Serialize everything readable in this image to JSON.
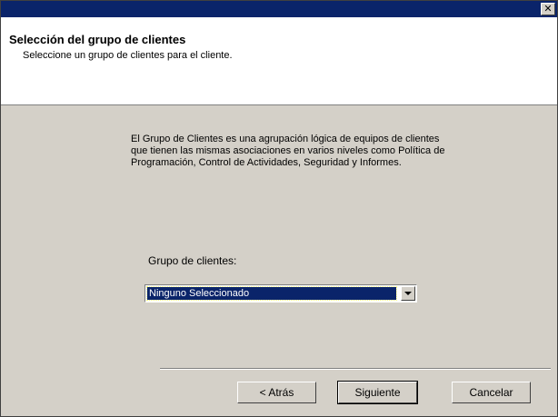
{
  "window": {
    "close_glyph": "✕"
  },
  "header": {
    "title": "Selección del grupo de clientes",
    "subtitle": "Seleccione un grupo de clientes para el cliente."
  },
  "main": {
    "description": "El Grupo de Clientes es una agrupación lógica de equipos de clientes que tienen las mismas asociaciones en varios niveles como Política de Programación, Control de Actividades, Seguridad y Informes.",
    "group_label": "Grupo de clientes:",
    "group_select": {
      "value": "Ninguno Seleccionado"
    }
  },
  "buttons": {
    "back": "< Atrás",
    "next": "Siguiente",
    "cancel": "Cancelar"
  },
  "colors": {
    "titlebar": "#0a246a",
    "dialog_bg": "#d4d0c8",
    "selection": "#0a246a"
  }
}
